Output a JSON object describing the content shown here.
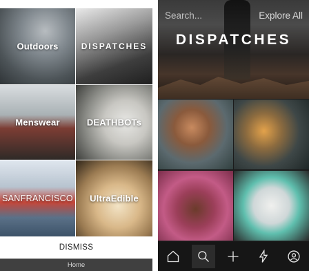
{
  "left": {
    "tiles": [
      {
        "label": "Outdoors"
      },
      {
        "label": "DISPATCHES"
      },
      {
        "label": "Menswear"
      },
      {
        "label": "DEATHBOTs"
      },
      {
        "label": "SANFRANCISCO"
      },
      {
        "label": "UltraEdible"
      }
    ],
    "dismiss_label": "DISMISS",
    "home_label": "Home"
  },
  "right": {
    "search": {
      "placeholder": "Search..."
    },
    "explore_label": "Explore All",
    "hero_title": "DISPATCHES",
    "tabbar": {
      "icons": [
        "home-icon",
        "search-icon",
        "plus-icon",
        "lightning-icon",
        "profile-icon"
      ],
      "active_index": 1
    }
  },
  "colors": {
    "tabbar_bg": "#161616",
    "home_bar_bg": "#404040",
    "text_on_image": "#ffffff"
  }
}
